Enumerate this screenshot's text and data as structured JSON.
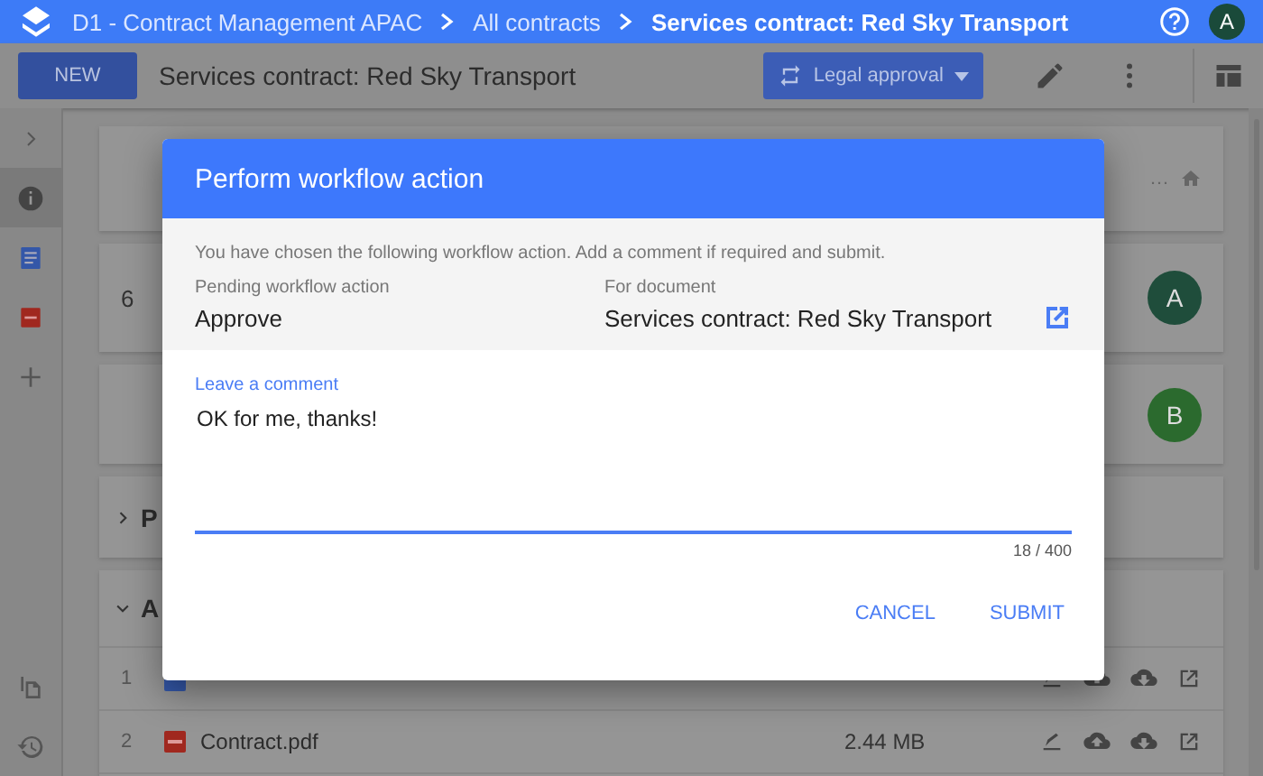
{
  "app_bar": {
    "breadcrumbs": [
      "D1 - Contract Management APAC",
      "All contracts",
      "Services contract: Red Sky Transport"
    ],
    "avatar": "A"
  },
  "toolbar": {
    "new_button": "NEW",
    "title": "Services contract: Red Sky Transport",
    "workflow_button": "Legal approval"
  },
  "sidebar": {
    "items": [
      {
        "kind": "info",
        "selected": true
      },
      {
        "kind": "document",
        "selected": false
      },
      {
        "kind": "pdf",
        "selected": false
      },
      {
        "kind": "add",
        "selected": false
      }
    ]
  },
  "people_cards": [
    {
      "value": "6",
      "avatar": "A",
      "color": "#1f4d3b"
    },
    {
      "avatar": "B",
      "color": "#2b6a2e"
    }
  ],
  "summary_card": {
    "overflow": "…"
  },
  "sections": [
    {
      "title": "P",
      "expanded": false
    },
    {
      "title": "A",
      "expanded": true
    }
  ],
  "attachments": [
    {
      "index": "1",
      "kind": "document"
    },
    {
      "index": "2",
      "name": "Contract.pdf",
      "kind": "pdf",
      "size": "2.44 MB"
    }
  ],
  "dialog": {
    "title": "Perform workflow action",
    "intro": "You have chosen the following workflow action. Add a comment if required and submit.",
    "action_label": "Pending workflow action",
    "action": "Approve",
    "document_label": "For document",
    "document": "Services contract: Red Sky Transport",
    "comment": {
      "label": "Leave a comment",
      "value": "OK for me, thanks!",
      "counter": "18 / 400"
    },
    "buttons": [
      "CANCEL",
      "SUBMIT"
    ]
  }
}
